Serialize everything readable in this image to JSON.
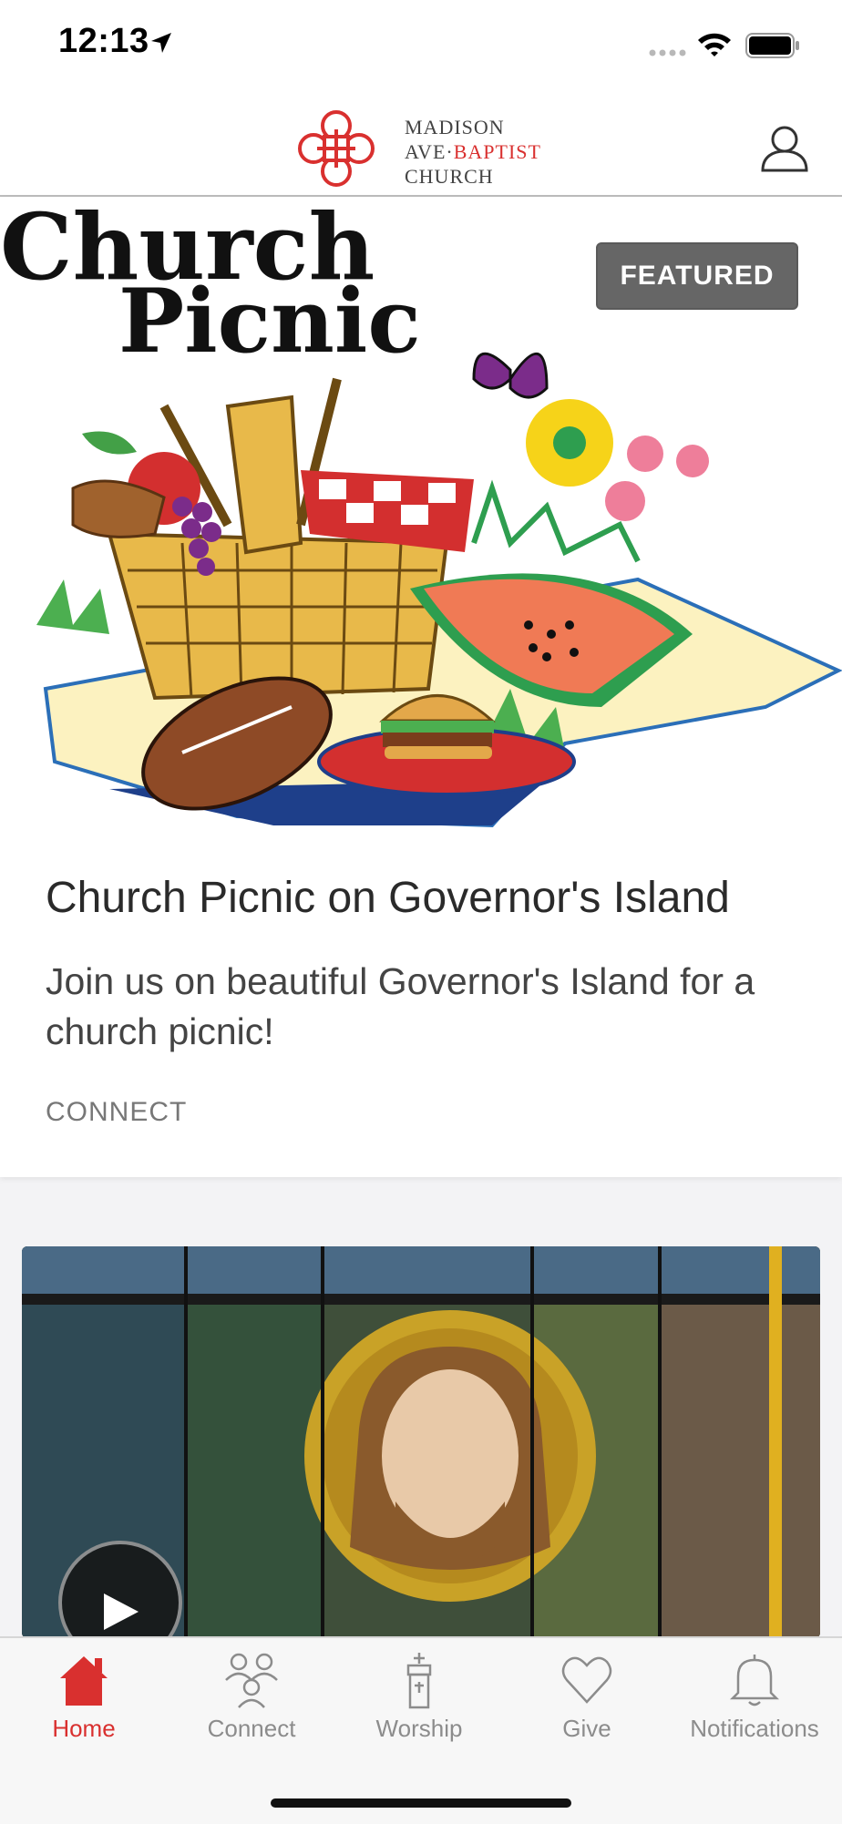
{
  "status_bar": {
    "time": "12:13"
  },
  "header": {
    "logo_line1": "MADISON",
    "logo_line2a": "AVE·",
    "logo_line2b": "BAPTIST",
    "logo_line3": "CHURCH"
  },
  "featured_card": {
    "badge": "FEATURED",
    "image_title_line1": "Church",
    "image_title_line2": "Picnic",
    "title": "Church Picnic on Governor's Island",
    "description": "Join us on beautiful Governor's Island for a church picnic!",
    "category": "CONNECT"
  },
  "tabs": [
    {
      "label": "Home",
      "icon": "home-icon",
      "active": true
    },
    {
      "label": "Connect",
      "icon": "people-icon",
      "active": false
    },
    {
      "label": "Worship",
      "icon": "steeple-icon",
      "active": false
    },
    {
      "label": "Give",
      "icon": "heart-icon",
      "active": false
    },
    {
      "label": "Notifications",
      "icon": "bell-icon",
      "active": false
    }
  ],
  "colors": {
    "accent": "#d9302f",
    "tab_inactive": "#8c8c8c",
    "badge": "#666666"
  }
}
